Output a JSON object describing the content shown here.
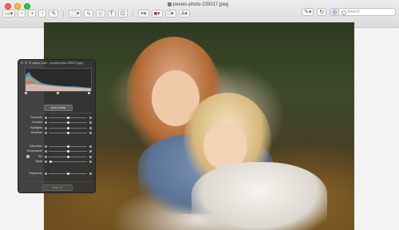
{
  "window": {
    "title": "pexels-photo-225017.jpeg",
    "traffic_lights": [
      "#fd5f57",
      "#febc2e",
      "#28c840"
    ]
  },
  "toolbar": {
    "left_icons": [
      "sidebar-icon",
      "zoom-out-icon",
      "zoom-in-icon",
      "share-icon",
      "pen-icon"
    ],
    "mid_icons": [
      "selection-icon",
      "shapes-icon",
      "text-icon",
      "crop-icon",
      "adjust-icon",
      "align-icon",
      "border-color-icon",
      "fill-color-icon",
      "font-icon"
    ],
    "right_icons": [
      "markup-icon",
      "rotate-icon",
      "annotate-icon"
    ],
    "search_placeholder": "Search"
  },
  "panel": {
    "title": "Adjust Color – pexels-photo-225017.jpeg",
    "auto_levels": "Auto Levels",
    "reset": "Reset All",
    "sliders": [
      {
        "label": "Exposure",
        "value": 0.5
      },
      {
        "label": "Contrast",
        "value": 0.5
      },
      {
        "label": "Highlights",
        "value": 0.5
      },
      {
        "label": "Shadows",
        "value": 0.5
      },
      {
        "label": "Saturation",
        "value": 0.5
      },
      {
        "label": "Temperature",
        "value": 0.5
      },
      {
        "label": "Tint",
        "value": 0.5
      },
      {
        "label": "Sepia",
        "value": 0.05
      },
      {
        "label": "Sharpness",
        "value": 0.5
      }
    ],
    "levels": [
      0.0,
      0.5,
      1.0
    ]
  },
  "colors": {
    "panel_bg": "#343434",
    "toolbar_bg": "#e4e4e4"
  }
}
